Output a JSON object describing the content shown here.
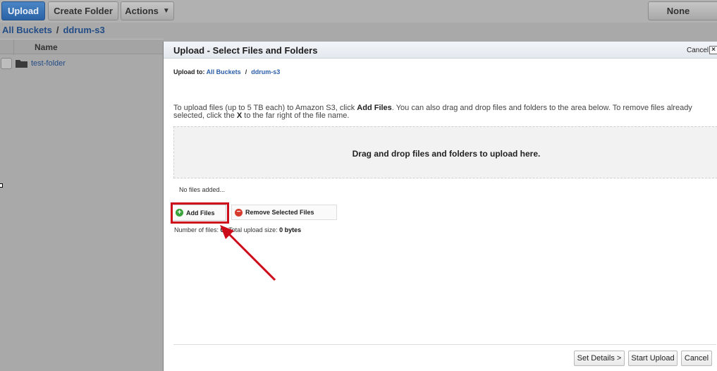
{
  "toolbar": {
    "upload_label": "Upload",
    "create_folder_label": "Create Folder",
    "actions_label": "Actions",
    "none_label": "None"
  },
  "breadcrumb": {
    "root": "All Buckets",
    "separator": "/",
    "bucket": "ddrum-s3"
  },
  "file_list": {
    "column_name": "Name",
    "items": [
      {
        "name": "test-folder",
        "icon": "folder-icon"
      }
    ]
  },
  "dialog": {
    "title": "Upload - Select Files and Folders",
    "cancel_link": "Cancel",
    "close_glyph": "×",
    "upload_to_label": "Upload to:",
    "upload_to_root": "All Buckets",
    "upload_to_sep": "/",
    "upload_to_bucket": "ddrum-s3",
    "instructions": {
      "part1": "To upload files (up to 5 TB each) to Amazon S3, click ",
      "bold1": "Add Files",
      "part2": ". You can also drag and drop files and folders to the area below. To remove files already selected, click the ",
      "bold2": "X",
      "part3": " to the far right of the file name."
    },
    "dropzone_text": "Drag and drop files and folders to upload here.",
    "no_files_text": "No files added...",
    "add_files_label": "Add Files",
    "remove_selected_label": "Remove Selected Files",
    "number_of_files_label": "Number of files:",
    "number_of_files_value": "0",
    "total_size_label": "Total upload size:",
    "total_size_value": "0 bytes",
    "footer": {
      "set_details_label": "Set Details >",
      "start_upload_label": "Start Upload",
      "cancel_label": "Cancel"
    }
  },
  "annotation": {
    "highlight_color": "#cc0c1a"
  }
}
